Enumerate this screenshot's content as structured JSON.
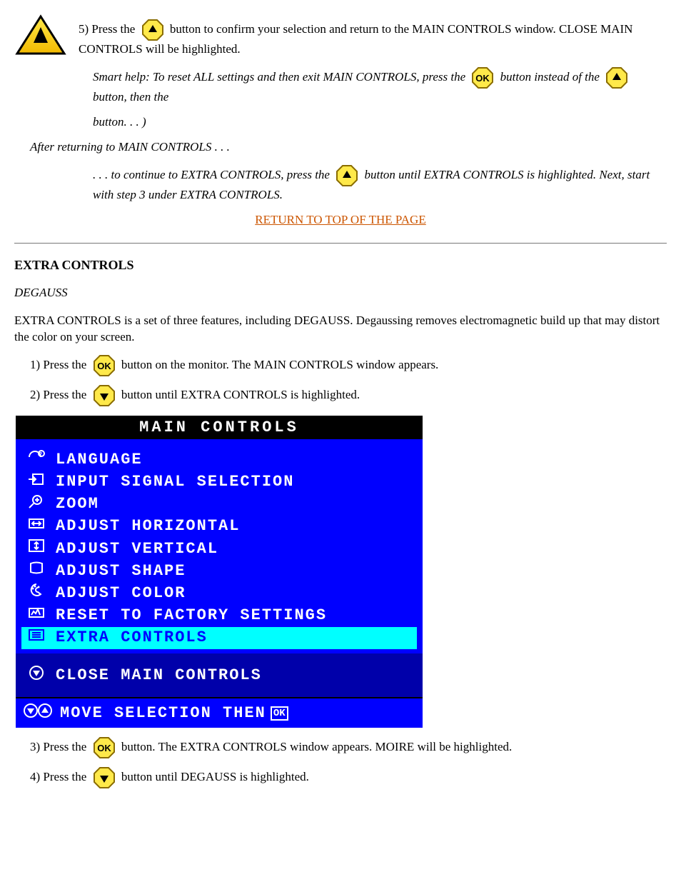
{
  "header": {
    "step5a": "5) Press the ",
    "step5b": " button to confirm your selection and return to the MAIN CONTROLS window. CLOSE MAIN CONTROLS will be highlighted.",
    "afterStep": "button. . . )",
    "okNote_a": " button instead of the ",
    "afterStepPrefix": "After returning to MAIN CONTROLS . . .",
    "step6a": ". . . to continue to EXTRA CONTROLS, press the ",
    "step6b": " button until EXTRA CONTROLS is highlighted. Next, start with step 3 under EXTRA CONTROLS.",
    "smartHelpNote_a": "Smart help: To reset ALL settings and then exit MAIN CONTROLS, press the ",
    "smartHelpNote_b": " button, then the "
  },
  "returnLink": "RETURN TO TOP OF THE PAGE",
  "section": {
    "title": "EXTRA CONTROLS",
    "degauss": "DEGAUSS",
    "intro": "EXTRA CONTROLS is a set of three features, including DEGAUSS. Degaussing removes electromagnetic build up that may distort the color on your screen.",
    "step1a": "1) Press the ",
    "step1b": " button on the monitor. The MAIN CONTROLS window appears.",
    "step2a": "2) Press the ",
    "step2b": " button until EXTRA CONTROLS is highlighted.",
    "step3a": "3) Press the ",
    "step3b": " button. The EXTRA CONTROLS window appears. MOIRE will be highlighted.",
    "step4a": "4) Press the ",
    "step4b": " button until DEGAUSS is highlighted."
  },
  "osd": {
    "title": "MAIN CONTROLS",
    "items": [
      {
        "icon": "lang",
        "label": "LANGUAGE"
      },
      {
        "icon": "input",
        "label": "INPUT SIGNAL SELECTION"
      },
      {
        "icon": "zoom",
        "label": "ZOOM"
      },
      {
        "icon": "horiz",
        "label": "ADJUST HORIZONTAL"
      },
      {
        "icon": "vert",
        "label": "ADJUST VERTICAL"
      },
      {
        "icon": "shape",
        "label": "ADJUST SHAPE"
      },
      {
        "icon": "color",
        "label": "ADJUST COLOR"
      },
      {
        "icon": "reset",
        "label": "RESET TO FACTORY SETTINGS"
      },
      {
        "icon": "extra",
        "label": "EXTRA CONTROLS",
        "selected": true
      }
    ],
    "close": "CLOSE MAIN CONTROLS",
    "footer": "MOVE SELECTION THEN",
    "footerBtn": "OK"
  }
}
